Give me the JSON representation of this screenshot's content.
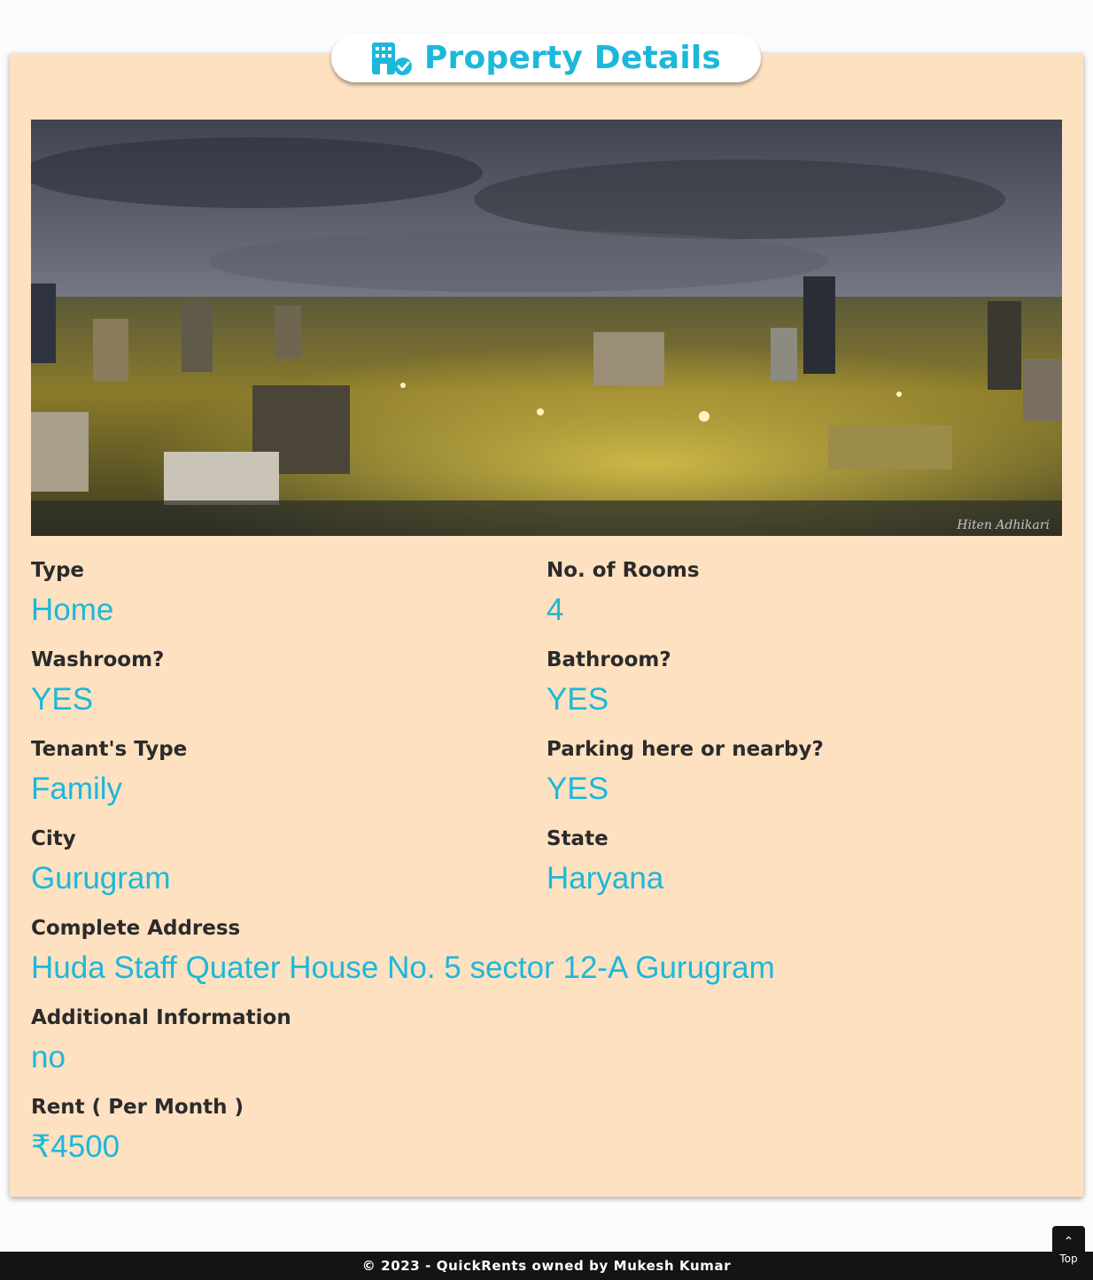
{
  "header": {
    "title": "Property Details",
    "icon": "building-check-icon",
    "accent_color": "#1cb8d9"
  },
  "image": {
    "description_icon": "city-photo",
    "watermark": "Hiten Adhikari"
  },
  "details": {
    "type_label": "Type",
    "type_value": "Home",
    "rooms_label": "No. of Rooms",
    "rooms_value": "4",
    "washroom_label": "Washroom?",
    "washroom_value": "YES",
    "bathroom_label": "Bathroom?",
    "bathroom_value": "YES",
    "tenant_label": "Tenant's Type",
    "tenant_value": "Family",
    "parking_label": "Parking here or nearby?",
    "parking_value": "YES",
    "city_label": "City",
    "city_value": "Gurugram",
    "state_label": "State",
    "state_value": "Haryana",
    "address_label": "Complete Address",
    "address_value": "Huda Staff Quater House No. 5 sector 12-A Gurugram",
    "info_label": "Additional Information",
    "info_value": "no",
    "rent_label": "Rent ( Per Month )",
    "rent_value": "₹4500"
  },
  "footer": {
    "text": "© 2023 - QuickRents owned by Mukesh Kumar"
  },
  "top_button": {
    "label": "Top",
    "icon": "chevron-up-icon"
  },
  "colors": {
    "card_background": "#fde1c1",
    "label_color": "#2b2b2b",
    "footer_background": "#141414"
  }
}
